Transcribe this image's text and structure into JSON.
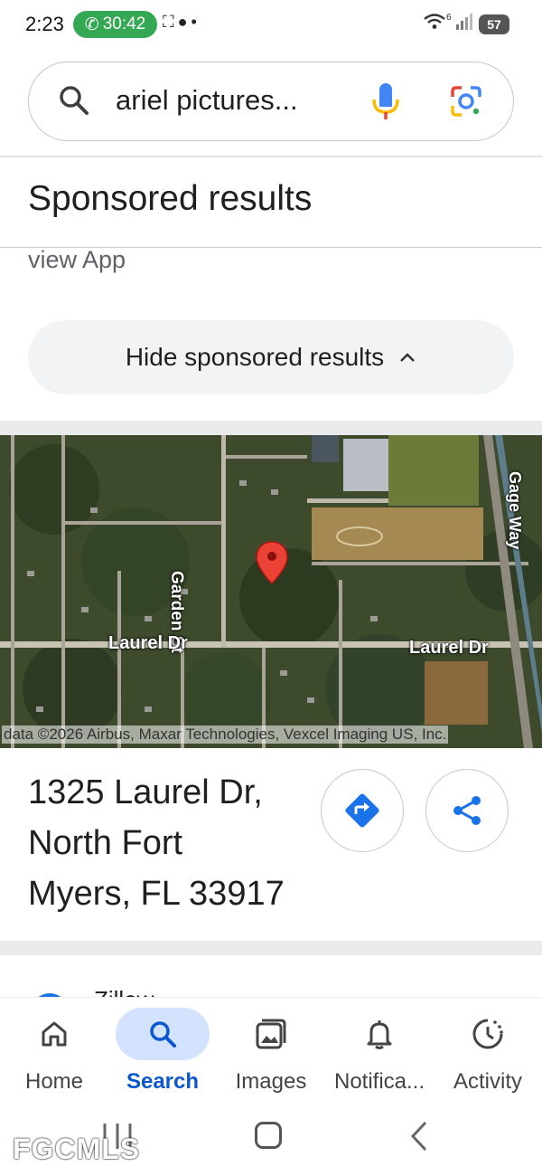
{
  "status_bar": {
    "time": "2:23",
    "call_timer": "30:42",
    "battery": "57",
    "network": "6"
  },
  "search": {
    "query": "ariel pictures..."
  },
  "sponsored": {
    "title": "Sponsored results",
    "view_app": "view App",
    "hide_button": "Hide sponsored results"
  },
  "map": {
    "labels": {
      "garden_st": "Garden St",
      "laurel_left": "Laurel Dr",
      "laurel_right": "Laurel Dr",
      "gage_way": "Gage Way"
    },
    "attribution": "data ©2026 Airbus, Maxar Technologies, Vexcel Imaging US, Inc."
  },
  "result": {
    "address": "1325 Laurel Dr,\nNorth Fort\nMyers, FL 33917"
  },
  "next_result": {
    "label": "Zillow"
  },
  "bottom_nav": {
    "home": "Home",
    "search": "Search",
    "images": "Images",
    "notifications": "Notifica...",
    "activity": "Activity"
  },
  "watermark": "FGCMLS",
  "colors": {
    "accent": "#0b57d0",
    "pin": "#ea4335",
    "call_pill": "#34a853"
  }
}
